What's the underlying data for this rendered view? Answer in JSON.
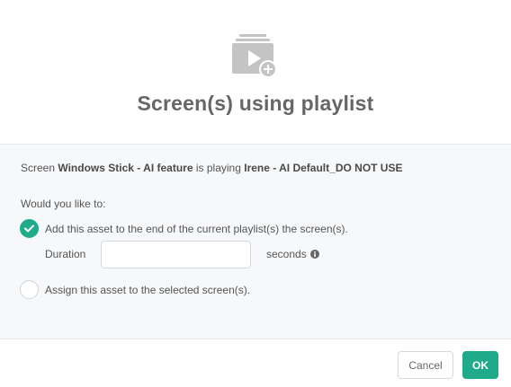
{
  "dialog": {
    "title": "Screen(s) using playlist",
    "header_icon": "playlist-add-icon"
  },
  "info": {
    "prefix": "Screen",
    "screen_name": "Windows Stick - AI feature",
    "middle": "is playing",
    "playlist_name": "Irene - AI Default_DO NOT USE"
  },
  "question": "Would you like to:",
  "options": {
    "append": {
      "label": "Add this asset to the end of the current playlist(s) the screen(s).",
      "selected": true
    },
    "assign": {
      "label": "Assign this asset to the selected screen(s).",
      "selected": false
    }
  },
  "duration": {
    "label": "Duration",
    "value": "",
    "unit": "seconds",
    "info_icon": "info-circle-icon"
  },
  "buttons": {
    "cancel": "Cancel",
    "ok": "OK"
  },
  "colors": {
    "accent": "#1fab89",
    "title": "#666666",
    "body_background": "#f7f8fa"
  }
}
